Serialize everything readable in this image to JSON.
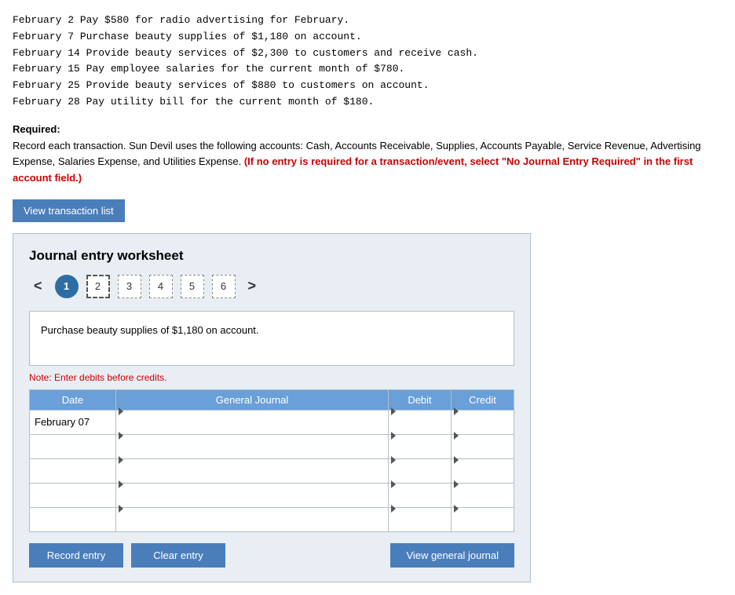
{
  "transactions": [
    {
      "date": "February  2",
      "text": "Pay $580 for radio advertising for February."
    },
    {
      "date": "February  7",
      "text": "Purchase beauty supplies of $1,180 on account."
    },
    {
      "date": "February 14",
      "text": "Provide beauty services of $2,300 to customers and receive cash."
    },
    {
      "date": "February 15",
      "text": "Pay employee salaries for the current month of $780."
    },
    {
      "date": "February 25",
      "text": "Provide beauty services of $880 to customers on account."
    },
    {
      "date": "February 28",
      "text": "Pay utility bill for the current month of $180."
    }
  ],
  "required": {
    "label": "Required:",
    "text1": "Record each transaction. Sun Devil uses the following accounts: Cash, Accounts Receivable, Supplies, Accounts Payable, Service Revenue, Advertising Expense, Salaries Expense, and Utilities Expense. ",
    "text2": "(If no entry is required for a transaction/event, select \"No Journal Entry Required\" in the first account field.)"
  },
  "view_transaction_btn": "View transaction list",
  "worksheet": {
    "title": "Journal entry worksheet",
    "nav_left": "<",
    "nav_right": ">",
    "tabs": [
      {
        "label": "1",
        "active": true,
        "circle": true
      },
      {
        "label": "2",
        "active": false,
        "dashed": true
      },
      {
        "label": "3",
        "active": false
      },
      {
        "label": "4",
        "active": false
      },
      {
        "label": "5",
        "active": false
      },
      {
        "label": "6",
        "active": false
      }
    ],
    "description": "Purchase beauty supplies of $1,180 on account.",
    "note": "Note: Enter debits before credits.",
    "table": {
      "headers": [
        "Date",
        "General Journal",
        "Debit",
        "Credit"
      ],
      "rows": [
        {
          "date": "February 07",
          "journal": "",
          "debit": "",
          "credit": ""
        },
        {
          "date": "",
          "journal": "",
          "debit": "",
          "credit": ""
        },
        {
          "date": "",
          "journal": "",
          "debit": "",
          "credit": ""
        },
        {
          "date": "",
          "journal": "",
          "debit": "",
          "credit": ""
        },
        {
          "date": "",
          "journal": "",
          "debit": "",
          "credit": ""
        }
      ]
    },
    "buttons": {
      "record": "Record entry",
      "clear": "Clear entry",
      "view_journal": "View general journal"
    }
  }
}
